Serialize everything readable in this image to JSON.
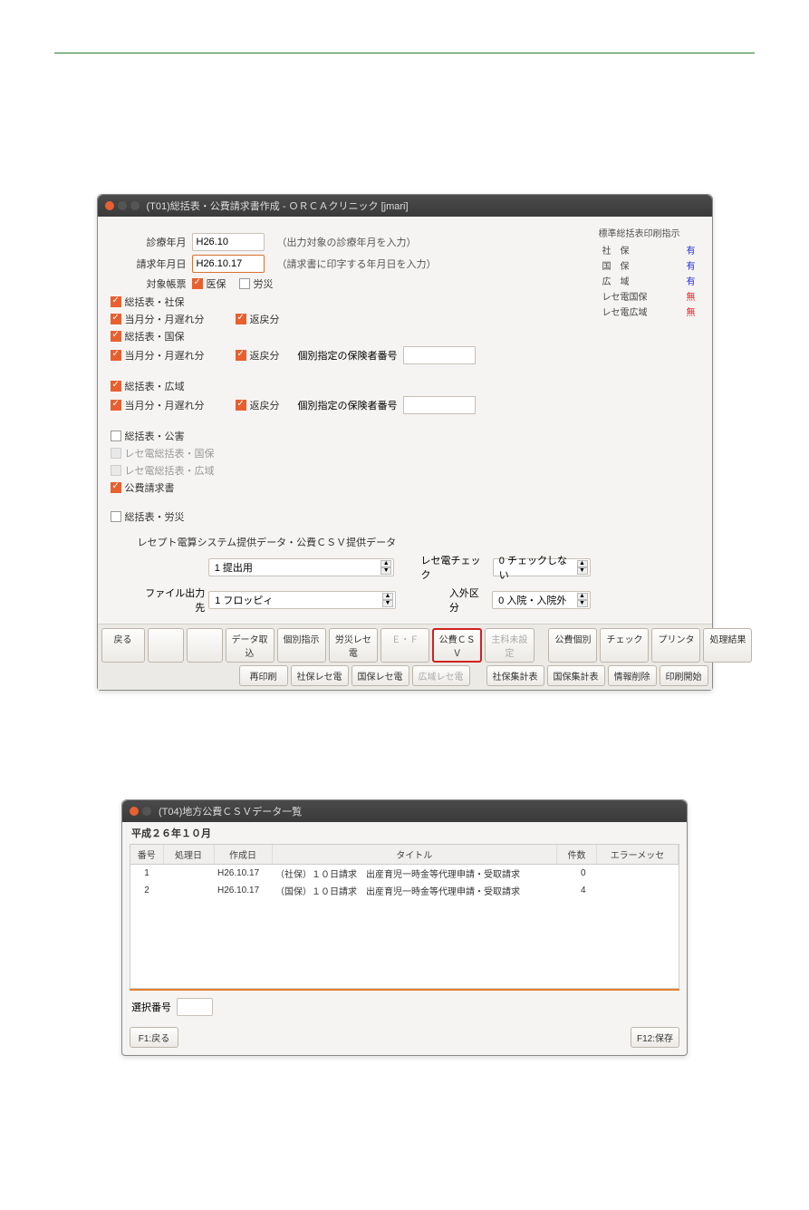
{
  "window1": {
    "title": "(T01)総括表・公費請求書作成 - ＯＲＣＡクリニック  [jmari]",
    "labels": {
      "shinryo_ym": "診療年月",
      "seikyu_ymd": "請求年月日",
      "taisho": "対象帳票",
      "shinryo_hint": "（出力対象の診療年月を入力）",
      "seikyu_hint": "（請求書に印字する年月日を入力）"
    },
    "values": {
      "shinryo_ym": "H26.10",
      "seikyu_ymd": "H26.10.17"
    },
    "targets": {
      "iho": "医保",
      "rousai": "労災"
    },
    "groups": {
      "shaho": "総括表・社保",
      "kokuho": "総括表・国保",
      "koiki": "総括表・広域",
      "kougai": "総括表・公害",
      "rece_kokuho": "レセ電総括表・国保",
      "rece_koiki": "レセ電総括表・広域",
      "kouhi_seikyu": "公費請求書",
      "rousai_sum": "総括表・労災",
      "tougetsu": "当月分・月遅れ分",
      "henrei": "返戻分",
      "hokensha": "個別指定の保険者番号"
    },
    "std_panel": {
      "title": "標準総括表印刷指示",
      "rows": [
        {
          "label": "社　保",
          "val": "有",
          "cls": "y"
        },
        {
          "label": "国　保",
          "val": "有",
          "cls": "y"
        },
        {
          "label": "広　域",
          "val": "有",
          "cls": "y"
        },
        {
          "label": "レセ電国保",
          "val": "無",
          "cls": "n"
        },
        {
          "label": "レセ電広域",
          "val": "無",
          "cls": "n"
        }
      ]
    },
    "section_label": "レセプト電算システム提供データ・公費ＣＳＶ提供データ",
    "combos": {
      "submit_label": "",
      "submit_val": "1 提出用",
      "rece_check_label": "レセ電チェック",
      "rece_check_val": "0 チェックしない",
      "file_out_label": "ファイル出力先",
      "file_out_val": "1 フロッピィ",
      "nyugai_label": "入外区分",
      "nyugai_val": "0 入院・入院外"
    },
    "buttons": {
      "back": "戻る",
      "dataload": "データ取込",
      "kobetsu": "個別指示",
      "rousai_rece": "労災レセ電",
      "ef": "Ｅ・Ｆ",
      "kouhi_csv": "公費ＣＳＶ",
      "mishu": "主科未設定",
      "kouhi_kobetsu": "公費個別",
      "check": "チェック",
      "printer": "プリンタ",
      "shori": "処理結果",
      "reprint": "再印刷",
      "sha_rece": "社保レセ電",
      "koku_rece": "国保レセ電",
      "koiki_rece": "広域レセ電",
      "sha_sum": "社保集計表",
      "koku_sum": "国保集計表",
      "info_del": "情報削除",
      "print_start": "印刷開始"
    }
  },
  "window2": {
    "title": "(T04)地方公費ＣＳＶデータ一覧",
    "header": "平成２６年１０月",
    "columns": {
      "no": "番号",
      "shori": "処理日",
      "create": "作成日",
      "title": "タイトル",
      "count": "件数",
      "err": "エラーメッセ"
    },
    "rows": [
      {
        "no": "1",
        "shori": "",
        "create": "H26.10.17",
        "title": "（社保）１０日請求　出産育児一時金等代理申請・受取請求",
        "count": "0"
      },
      {
        "no": "2",
        "shori": "",
        "create": "H26.10.17",
        "title": "（国保）１０日請求　出産育児一時金等代理申請・受取請求",
        "count": "4"
      }
    ],
    "sel_label": "選択番号",
    "btn_back": "F1:戻る",
    "btn_save": "F12:保存"
  }
}
